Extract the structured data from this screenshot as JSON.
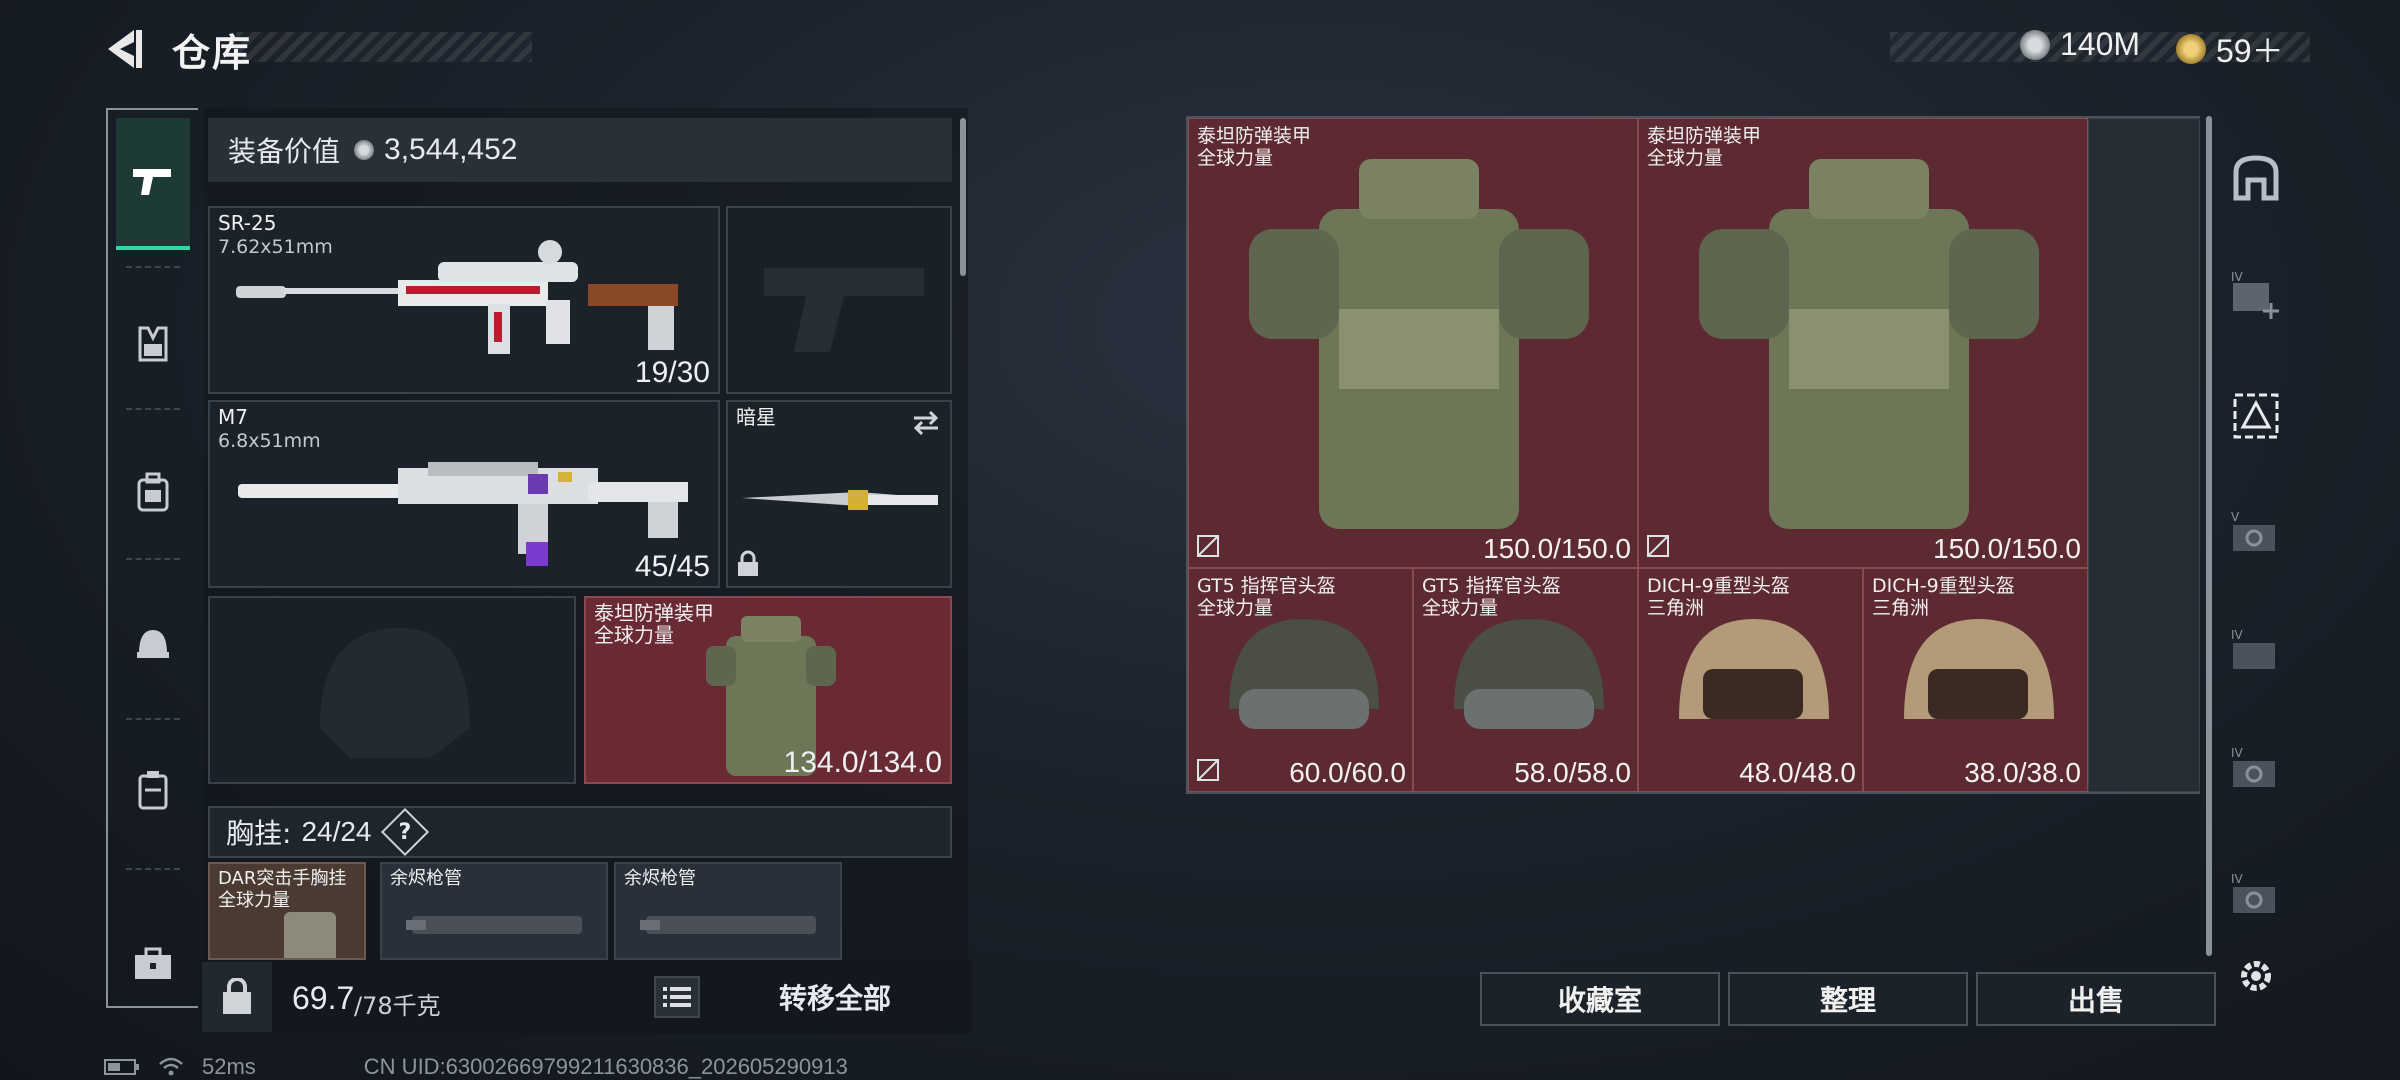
{
  "header": {
    "title": "仓库",
    "currency_silver": "140M",
    "currency_gold": "59＋"
  },
  "left_tabs": [
    {
      "name": "weapons",
      "icon": "pistol-icon",
      "active": true
    },
    {
      "name": "armor",
      "icon": "vest-icon"
    },
    {
      "name": "backpack",
      "icon": "backpack-icon"
    },
    {
      "name": "helmet",
      "icon": "helmet-icon"
    },
    {
      "name": "container",
      "icon": "case-icon"
    },
    {
      "name": "tools",
      "icon": "toolbox-icon"
    }
  ],
  "loadout": {
    "equip_value_label": "装备价值",
    "equip_value": "3,544,452",
    "primary1": {
      "name": "SR-25",
      "caliber": "7.62x51mm",
      "ammo": "19/30"
    },
    "primary2": {
      "name": "M7",
      "caliber": "6.8x51mm",
      "ammo": "45/45"
    },
    "melee": {
      "name": "暗星"
    },
    "armor": {
      "name": "泰坦防弹装甲",
      "tag": "全球力量",
      "durability": "134.0/134.0"
    },
    "rig_label": "胸挂:",
    "rig_capacity": "24/24",
    "rig_help": "?",
    "rig_items": [
      {
        "name": "DAR突击手胸挂",
        "tag": "全球力量"
      },
      {
        "name": "余烬枪管"
      },
      {
        "name": "余烬枪管"
      }
    ]
  },
  "weight": {
    "current": "69.7",
    "max": "/78千克",
    "transfer_all": "转移全部"
  },
  "storage": {
    "armors": [
      {
        "name": "泰坦防弹装甲",
        "tag": "全球力量",
        "durability": "150.0/150.0"
      },
      {
        "name": "泰坦防弹装甲",
        "tag": "全球力量",
        "durability": "150.0/150.0"
      }
    ],
    "helmets": [
      {
        "name": "GT5 指挥官头盔",
        "tag": "全球力量",
        "durability": "60.0/60.0"
      },
      {
        "name": "GT5 指挥官头盔",
        "tag": "全球力量",
        "durability": "58.0/58.0"
      },
      {
        "name": "DICH-9重型头盔",
        "tag": "三角洲",
        "durability": "48.0/48.0"
      },
      {
        "name": "DICH-9重型头盔",
        "tag": "三角洲",
        "durability": "38.0/38.0"
      }
    ]
  },
  "buttons": {
    "collection": "收藏室",
    "organize": "整理",
    "sell": "出售"
  },
  "status": {
    "ping": "52ms",
    "uid": "CN UID:63002669799211630836_202605290913"
  },
  "colors": {
    "accent": "#2fd8a6",
    "item_red": "#5e2a32"
  }
}
